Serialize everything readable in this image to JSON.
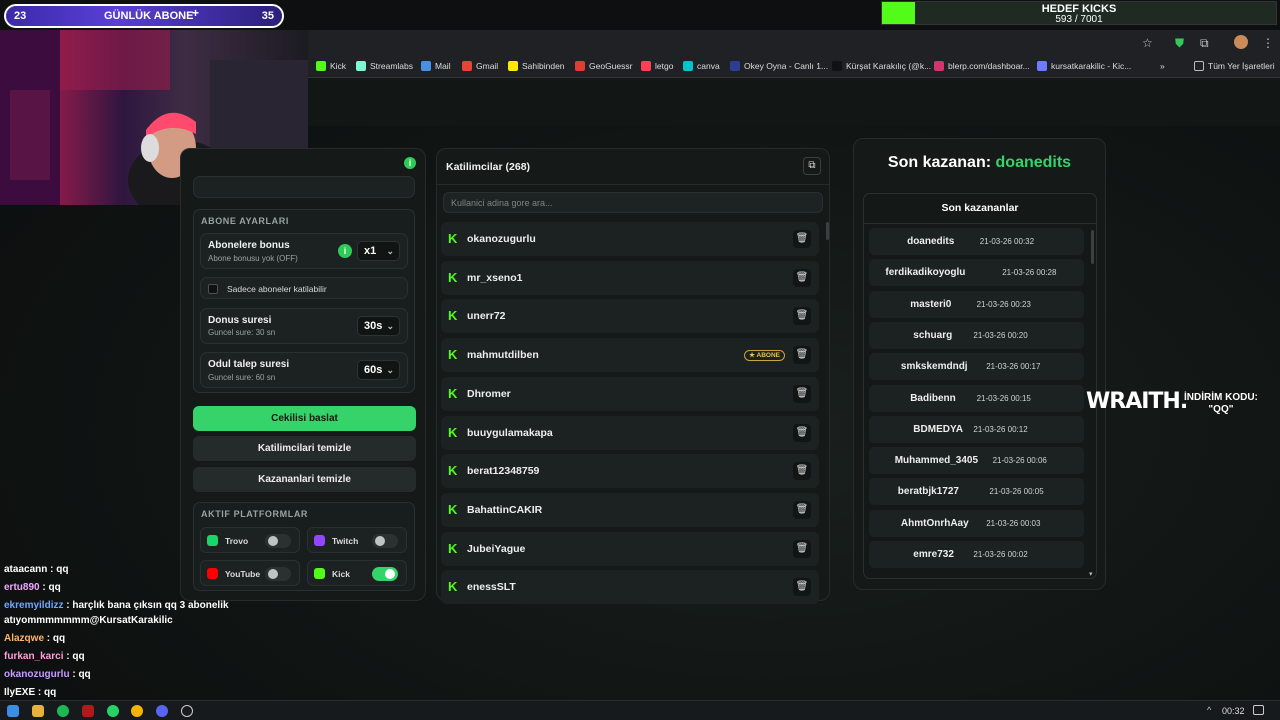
{
  "overlay": {
    "sub_left": "23",
    "sub_title": "GÜNLÜK ABONE",
    "sub_plus": "+",
    "sub_right": "35",
    "goal_title": "HEDEF KICKS",
    "goal_progress": "593 / 7001",
    "goal_fraction": 0.085
  },
  "bookmarks": [
    {
      "label": "Kick",
      "color": "#53fc18"
    },
    {
      "label": "Streamlabs",
      "color": "#80f5d2"
    },
    {
      "label": "Mail",
      "color": "#4a90e2"
    },
    {
      "label": "Gmail",
      "color": "#ea4335"
    },
    {
      "label": "Sahibinden",
      "color": "#ffe800"
    },
    {
      "label": "GeoGuessr",
      "color": "#e53935"
    },
    {
      "label": "letgo",
      "color": "#ff3f55"
    },
    {
      "label": "canva",
      "color": "#00c4cc"
    },
    {
      "label": "Okey Oyna - Canlı 1...",
      "color": "#2c3e91"
    },
    {
      "label": "Kürşat Karakılıç (@k...",
      "color": "#111111"
    },
    {
      "label": "blerp.com/dashboar...",
      "color": "#d6336c"
    },
    {
      "label": "kursatkarakilic - Kic...",
      "color": "#6c7cff"
    }
  ],
  "bookmarks_all": "Tüm Yer İşaretleri",
  "settings": {
    "section_title": "ABONE AYARLARI",
    "bonus_title": "Abonelere bonus",
    "bonus_sub": "Abone bonusu yok (OFF)",
    "bonus_value": "x1",
    "only_subs_label": "Sadece aboneler katilabilir",
    "turn_title": "Donus suresi",
    "turn_sub": "Guncel sure: 30 sn",
    "turn_value": "30s",
    "claim_title": "Odul talep suresi",
    "claim_sub": "Guncel sure: 60 sn",
    "claim_value": "60s",
    "start_button": "Cekilisi baslat",
    "clear_participants": "Katilimcilari temizle",
    "clear_winners": "Kazananlari temizle",
    "platforms_title": "AKTIF PLATFORMLAR",
    "platforms": [
      {
        "label": "Trovo",
        "color": "#19d66b",
        "on": false
      },
      {
        "label": "Twitch",
        "color": "#9146ff",
        "on": false
      },
      {
        "label": "YouTube",
        "color": "#ff0000",
        "on": false
      },
      {
        "label": "Kick",
        "color": "#53fc18",
        "on": true
      }
    ]
  },
  "participants": {
    "title": "Katilimcilar (268)",
    "search_placeholder": "Kullanici adina gore ara...",
    "badge_label": "★ ABONE",
    "list": [
      "okanozugurlu",
      "mr_xseno1",
      "unerr72",
      "mahmutdilben",
      "Dhromer",
      "buuygulamakapa",
      "berat12348759",
      "BahattinCAKIR",
      "JubeiYague",
      "enessSLT"
    ]
  },
  "winners": {
    "last_winner_prefix": "Son kazanan:",
    "last_winner_name": "doanedits",
    "list_title": "Son kazananlar",
    "list": [
      {
        "name": "doanedits",
        "date": "21-03-26 00:32"
      },
      {
        "name": "ferdikadikoyoglu",
        "date": "21-03-26 00:28"
      },
      {
        "name": "masteri0",
        "date": "21-03-26 00:23"
      },
      {
        "name": "schuarg",
        "date": "21-03-26 00:20"
      },
      {
        "name": "smkskemdndj",
        "date": "21-03-26 00:17"
      },
      {
        "name": "Badibenn",
        "date": "21-03-26 00:15"
      },
      {
        "name": "BDMEDYA",
        "date": "21-03-26 00:12"
      },
      {
        "name": "Muhammed_3405",
        "date": "21-03-26 00:06"
      },
      {
        "name": "beratbjk1727",
        "date": "21-03-26 00:05"
      },
      {
        "name": "AhmtOnrhAay",
        "date": "21-03-26 00:03"
      },
      {
        "name": "emre732",
        "date": "21-03-26 00:02"
      }
    ]
  },
  "sponsor": {
    "brand": "WRAITH.",
    "line1": "İNDİRİM KODU:",
    "line2": "\"QQ\""
  },
  "chat": [
    {
      "user": "ataacann",
      "msg": " : qq",
      "color": "#ffffff"
    },
    {
      "user": "ertu890",
      "msg": " : qq",
      "color": "#f0a8ff"
    },
    {
      "user": "ekremyildizz",
      "msg": " : harçlık bana çıksın qq 3 abonelik",
      "color": "#6fa8ff"
    },
    {
      "user": "",
      "msg": "atıyommmmmmm@KursatKarakilic",
      "color": "#ffffff"
    },
    {
      "user": "Alazqwe",
      "msg": " : qq",
      "color": "#ffb36b"
    },
    {
      "user": "furkan_karci",
      "msg": " : qq",
      "color": "#ff9ed8"
    },
    {
      "user": "okanozugurlu",
      "msg": " : qq",
      "color": "#c89bff"
    },
    {
      "user": "IlyEXE",
      "msg": " : qq",
      "color": "#ffffff"
    }
  ],
  "taskbar": {
    "time": "00:32"
  }
}
